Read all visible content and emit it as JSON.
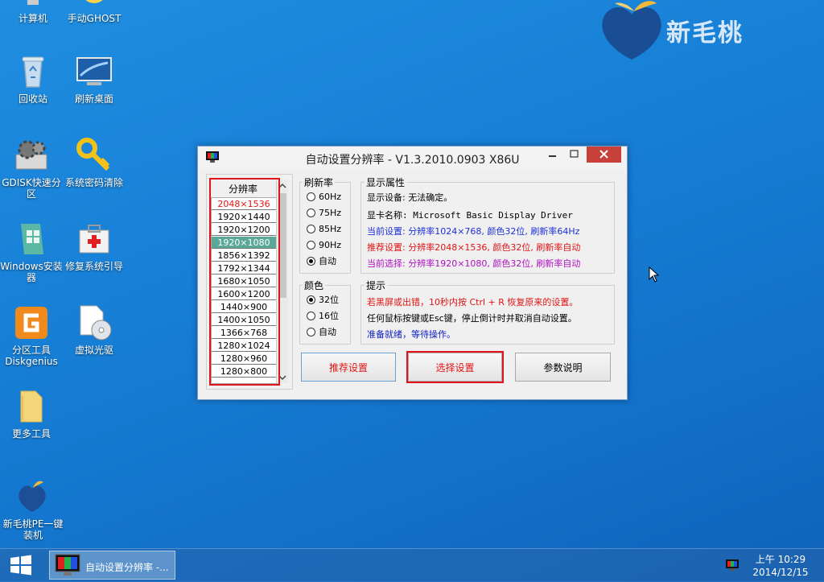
{
  "desktop": {
    "icons": [
      {
        "label": "计算机"
      },
      {
        "label": "手动GHOST"
      },
      {
        "label": "回收站"
      },
      {
        "label": "刷新桌面"
      },
      {
        "label": "GDISK快速分区"
      },
      {
        "label": "系统密码清除"
      },
      {
        "label": "Windows安装器"
      },
      {
        "label": "修复系统引导"
      },
      {
        "label": "分区工具Diskgenius"
      },
      {
        "label": "虚拟光驱"
      },
      {
        "label": "更多工具"
      },
      {
        "label": "新毛桃PE一键装机"
      }
    ],
    "brand_name": "新毛桃"
  },
  "window": {
    "title": "自动设置分辨率 - V1.3.2010.0903 X86U",
    "resolution": {
      "header": "分辨率",
      "items": [
        "2048×1536",
        "1920×1440",
        "1920×1200",
        "1920×1080",
        "1856×1392",
        "1792×1344",
        "1680×1050",
        "1600×1200",
        "1440×900",
        "1400×1050",
        "1366×768",
        "1280×1024",
        "1280×960",
        "1280×800"
      ],
      "selected": "1920×1080",
      "recommended": "2048×1536"
    },
    "refresh": {
      "legend": "刷新率",
      "options": [
        "60Hz",
        "75Hz",
        "85Hz",
        "90Hz",
        "自动"
      ],
      "selected": "自动"
    },
    "color": {
      "legend": "颜色",
      "options": [
        "32位",
        "16位",
        "自动"
      ],
      "selected": "32位"
    },
    "display": {
      "legend": "显示属性",
      "device": "显示设备: 无法确定。",
      "card": "显卡名称: Microsoft Basic Display Driver",
      "current": "当前设置: 分辨率1024×768, 颜色32位, 刷新率64Hz",
      "recommended": "推荐设置: 分辨率2048×1536, 颜色32位, 刷新率自动",
      "chosen": "当前选择: 分辨率1920×1080, 颜色32位, 刷新率自动"
    },
    "tips": {
      "legend": "提示",
      "line1": "若黑屏或出错，10秒内按 Ctrl + R 恢复原来的设置。",
      "line2": "任何鼠标按键或Esc键，停止倒计时并取消自动设置。",
      "line3": "准备就绪，等待操作。"
    },
    "buttons": {
      "recommend": "推荐设置",
      "choose": "选择设置",
      "help": "参数说明"
    },
    "colors": {
      "current": "#1d2fd8",
      "recommended": "#e01414",
      "chosen": "#b010c0",
      "tip_ok": "#1020c0",
      "highlight": "#e0141c"
    }
  },
  "taskbar": {
    "task_label": "自动设置分辨率 -...",
    "time": "上午 10:29",
    "date": "2014/12/15"
  }
}
